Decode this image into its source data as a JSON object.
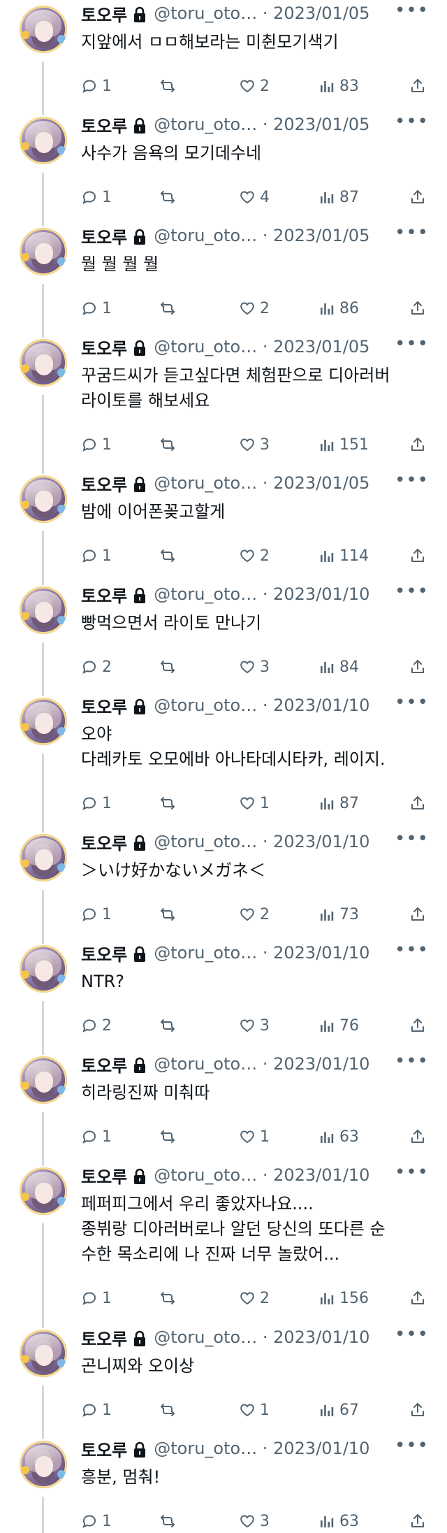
{
  "author": {
    "name": "토오루",
    "handle": "@toru_oto…",
    "separator": "·"
  },
  "tweets": [
    {
      "date": "2023/01/05",
      "text": "지앞에서 ㅁㅁ해보라는 미췬모기색기",
      "replies": "1",
      "likes": "2",
      "views": "83"
    },
    {
      "date": "2023/01/05",
      "text": "사수가 음욕의 모기데수네",
      "replies": "1",
      "likes": "4",
      "views": "87"
    },
    {
      "date": "2023/01/05",
      "text": "뭘 뭘 뭘 뭘",
      "replies": "1",
      "likes": "2",
      "views": "86"
    },
    {
      "date": "2023/01/05",
      "text": "꾸굼드씨가 듣고싶다면 체험판으로 디아러버\n라이토를 해보세요",
      "replies": "1",
      "likes": "3",
      "views": "151"
    },
    {
      "date": "2023/01/05",
      "text": "밤에 이어폰꽂고할게",
      "replies": "1",
      "likes": "2",
      "views": "114"
    },
    {
      "date": "2023/01/10",
      "text": "빵먹으면서 라이토 만나기",
      "replies": "2",
      "likes": "3",
      "views": "84"
    },
    {
      "date": "2023/01/10",
      "text": "오야\n다레카토 오모에바 아나타데시타카, 레이지.",
      "replies": "1",
      "likes": "1",
      "views": "87"
    },
    {
      "date": "2023/01/10",
      "text": "＞いけ好かないメガネ＜",
      "replies": "1",
      "likes": "2",
      "views": "73"
    },
    {
      "date": "2023/01/10",
      "text": "NTR?",
      "replies": "2",
      "likes": "3",
      "views": "76"
    },
    {
      "date": "2023/01/10",
      "text": "히라링진짜 미춰따",
      "replies": "1",
      "likes": "1",
      "views": "63"
    },
    {
      "date": "2023/01/10",
      "text": "페퍼피그에서 우리 좋았자나요....\n종뷔랑 디아러버로나 알던 당신의 또다른 순\n수한 목소리에 나 진짜 너무 놀랐어...",
      "replies": "1",
      "likes": "2",
      "views": "156"
    },
    {
      "date": "2023/01/10",
      "text": "곤니찌와 오이상",
      "replies": "1",
      "likes": "1",
      "views": "67"
    },
    {
      "date": "2023/01/10",
      "text": "흥분, 멈춰!",
      "replies": "1",
      "likes": "3",
      "views": "63"
    }
  ]
}
